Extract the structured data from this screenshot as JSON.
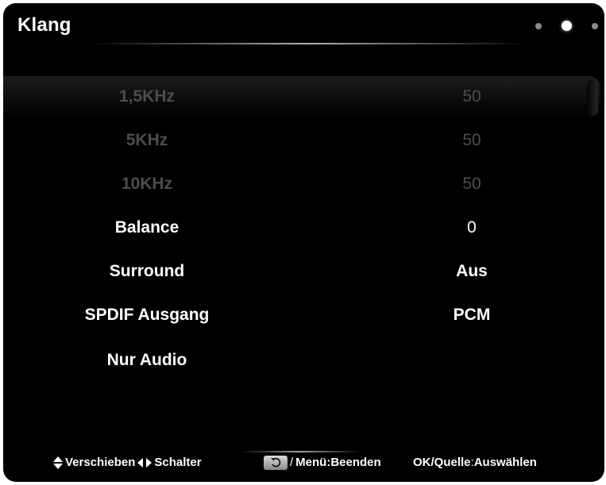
{
  "window": {
    "title": "Klang",
    "page_dots": [
      {
        "name": "page-dot-1",
        "active": false
      },
      {
        "name": "page-dot-2",
        "active": true
      },
      {
        "name": "page-dot-3",
        "active": false
      }
    ]
  },
  "menu": {
    "items": [
      {
        "label": "1,5KHz",
        "value": "50",
        "state": "disabled"
      },
      {
        "label": "5KHz",
        "value": "50",
        "state": "disabled"
      },
      {
        "label": "10KHz",
        "value": "50",
        "state": "disabled"
      },
      {
        "label": "Balance",
        "value": "0",
        "state": "enabled"
      },
      {
        "label": "Surround",
        "value": "Aus",
        "state": "enabled"
      },
      {
        "label": "SPDIF Ausgang",
        "value": "PCM",
        "state": "enabled"
      },
      {
        "label": "Nur Audio",
        "value": "",
        "state": "enabled"
      }
    ]
  },
  "footer": {
    "move": "Verschieben",
    "switch": "Schalter",
    "menu_exit": "Menü:Beenden",
    "ok_source": "OK/Quelle",
    "select": "Auswählen",
    "slash": "/",
    "colon": ":"
  },
  "colors": {
    "background": "#000000",
    "text": "#ffffff",
    "disabled_text": "#4d4d4d"
  },
  "icons": [
    "up-down-arrows-icon",
    "left-right-arrows-icon",
    "back-icon"
  ]
}
